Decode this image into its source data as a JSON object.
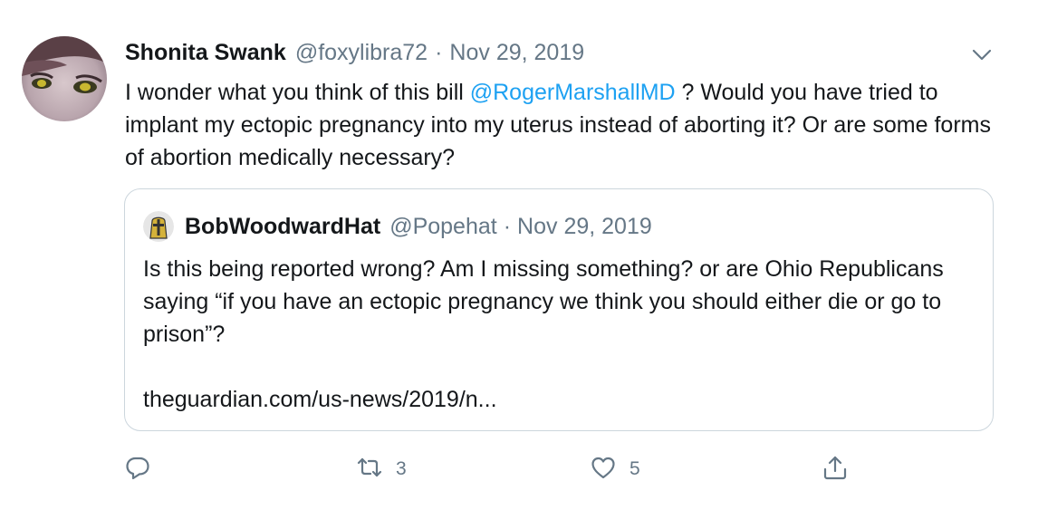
{
  "tweet": {
    "author_name": "Shonita Swank",
    "author_handle": "@foxylibra72",
    "separator": "·",
    "date": "Nov 29, 2019",
    "text_before": "I wonder what you think of this bill ",
    "mention": "@RogerMarshallMD",
    "text_after": " ? Would you have tried to implant my ectopic pregnancy into my uterus instead of aborting it? Or are some forms of abortion medically necessary?"
  },
  "quoted": {
    "author_name": "BobWoodwardHat",
    "author_handle": "@Popehat",
    "separator": "·",
    "date": "Nov 29, 2019",
    "text": "Is this being reported wrong? Am I missing something? or are Ohio Republicans saying “if you have an ectopic pregnancy we think you should either die or go to prison”?",
    "link": "theguardian.com/us-news/2019/n..."
  },
  "actions": {
    "reply_icon": "reply-icon",
    "retweet_icon": "retweet-icon",
    "retweet_count": "3",
    "like_icon": "heart-icon",
    "like_count": "5",
    "share_icon": "share-icon"
  },
  "colors": {
    "accent": "#1da1f2",
    "secondary_text": "#657786",
    "border": "#ccd6dd",
    "text": "#14171a"
  }
}
